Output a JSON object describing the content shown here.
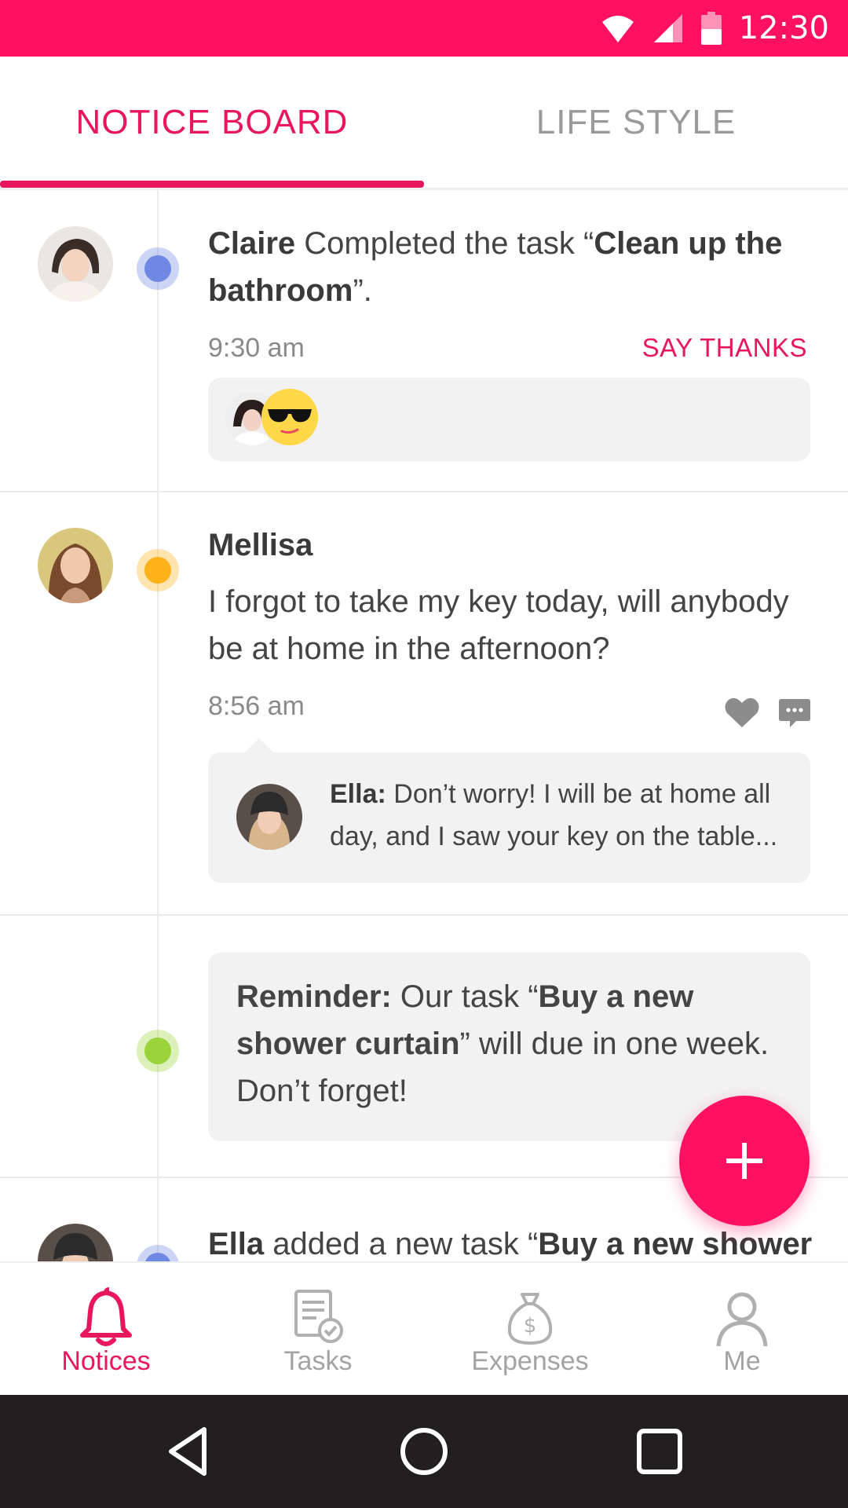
{
  "status_bar": {
    "time": "12:30",
    "icons": [
      "wifi-icon",
      "signal-icon",
      "battery-icon"
    ]
  },
  "tabs": [
    {
      "label": "NOTICE BOARD",
      "active": true
    },
    {
      "label": "LIFE STYLE",
      "active": false
    }
  ],
  "feed": [
    {
      "type": "task_completed",
      "dot_color": "#6f88e3",
      "author": "Claire",
      "text_middle": " Completed the task “",
      "task": "Clean up the bathroom",
      "text_end": "”.",
      "time": "9:30 am",
      "action": "SAY THANKS"
    },
    {
      "type": "post",
      "dot_color": "#ffb21a",
      "author": "Mellisa",
      "message": "I forgot to take my key today, will anybody be at home in the afternoon?",
      "time": "8:56 am",
      "reply": {
        "author": "Ella:",
        "text": " Don’t worry! I will be at home all day, and I saw your key on the table..."
      }
    },
    {
      "type": "reminder",
      "dot_color": "#9ad33a",
      "label": "Reminder:",
      "text_before": " Our task “",
      "task": "Buy a new shower curtain",
      "text_after": "” will due in one week. Don’t forget!"
    },
    {
      "type": "task_added",
      "dot_color": "#6f88e3",
      "author": "Ella",
      "text_middle": " added a new task “",
      "task": "Buy a new shower"
    }
  ],
  "fab": {
    "icon": "plus-icon"
  },
  "bottom_nav": [
    {
      "label": "Notices",
      "icon": "bell-icon",
      "active": true
    },
    {
      "label": "Tasks",
      "icon": "tasks-icon",
      "active": false
    },
    {
      "label": "Expenses",
      "icon": "money-bag-icon",
      "active": false
    },
    {
      "label": "Me",
      "icon": "person-icon",
      "active": false
    }
  ],
  "colors": {
    "accent": "#e8175d",
    "status_bar": "#ff1060",
    "system_nav": "#231f20"
  }
}
